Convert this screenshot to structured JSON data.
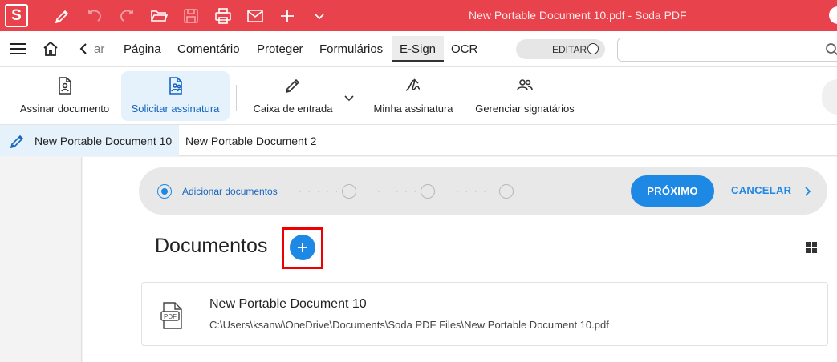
{
  "app": {
    "logo_letter": "S",
    "window_title": "New Portable Document 10.pdf   -   Soda PDF"
  },
  "menu": {
    "tabs": [
      {
        "label": "ar"
      },
      {
        "label": "Página"
      },
      {
        "label": "Comentário"
      },
      {
        "label": "Proteger"
      },
      {
        "label": "Formulários"
      },
      {
        "label": "E-Sign",
        "active": true
      },
      {
        "label": "OCR"
      }
    ],
    "edit_toggle_label": "EDITAR",
    "search_placeholder": ""
  },
  "ribbon": {
    "items": [
      {
        "label": "Assinar documento",
        "icon": "sign-document-icon"
      },
      {
        "label": "Solicitar assinatura",
        "icon": "request-signature-icon",
        "active": true
      },
      {
        "label": "Caixa de entrada",
        "icon": "pen-nib-icon"
      },
      {
        "label": "Minha assinatura",
        "icon": "signature-icon"
      },
      {
        "label": "Gerenciar signatários",
        "icon": "users-icon"
      }
    ]
  },
  "doc_tabs": [
    {
      "label": "New Portable Document 10",
      "active": true
    },
    {
      "label": "New Portable Document 2"
    }
  ],
  "stepper": {
    "step1_label": "Adicionar documentos",
    "dots": "· · · · ·",
    "next_label": "PRÓXIMO",
    "cancel_label": "CANCELAR"
  },
  "documents": {
    "heading": "Documentos",
    "items": [
      {
        "name": "New Portable Document 10",
        "path": "C:\\Users\\ksanw\\OneDrive\\Documents\\Soda PDF Files\\New Portable Document 10.pdf",
        "icon_text": "PDF"
      }
    ]
  },
  "colors": {
    "titlebar": "#e8424d",
    "accent": "#1e88e5",
    "highlight_frame": "#ee0000"
  }
}
